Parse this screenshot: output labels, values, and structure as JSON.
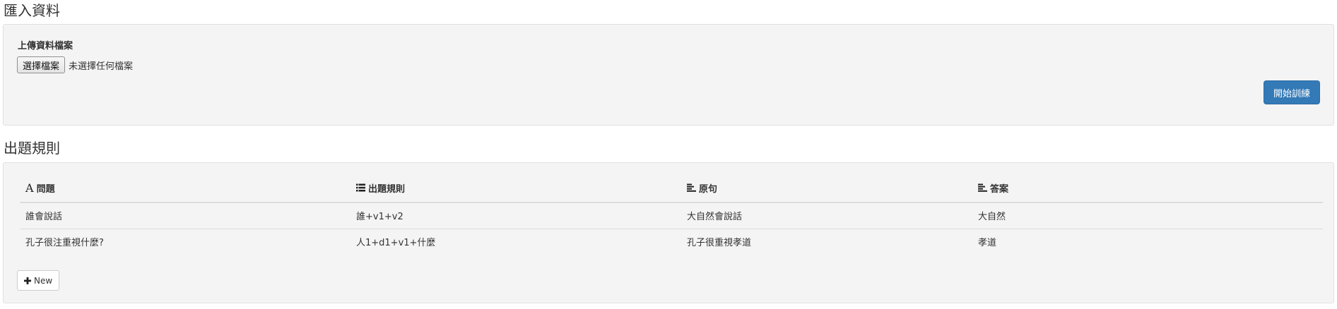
{
  "import_section": {
    "title": "匯入資料",
    "upload_label": "上傳資料檔案",
    "file_button_label": "選擇檔案",
    "file_status": "未選擇任何檔案",
    "start_button_label": "開始訓練"
  },
  "rules_section": {
    "title": "出題規則",
    "columns": [
      {
        "label": "問題",
        "icon": "font-icon"
      },
      {
        "label": "出題規則",
        "icon": "list-icon"
      },
      {
        "label": "原句",
        "icon": "align-left-icon"
      },
      {
        "label": "答案",
        "icon": "align-left-icon"
      }
    ],
    "rows": [
      [
        "誰會說話",
        "誰+v1+v2",
        "大自然會說話",
        "大自然"
      ],
      [
        "孔子很注重視什麼?",
        "人1+d1+v1+什麼",
        "孔子很重視孝道",
        "孝道"
      ]
    ],
    "new_button_label": "New"
  },
  "colors": {
    "primary": "#337ab7",
    "panel_bg": "#f4f4f4"
  }
}
